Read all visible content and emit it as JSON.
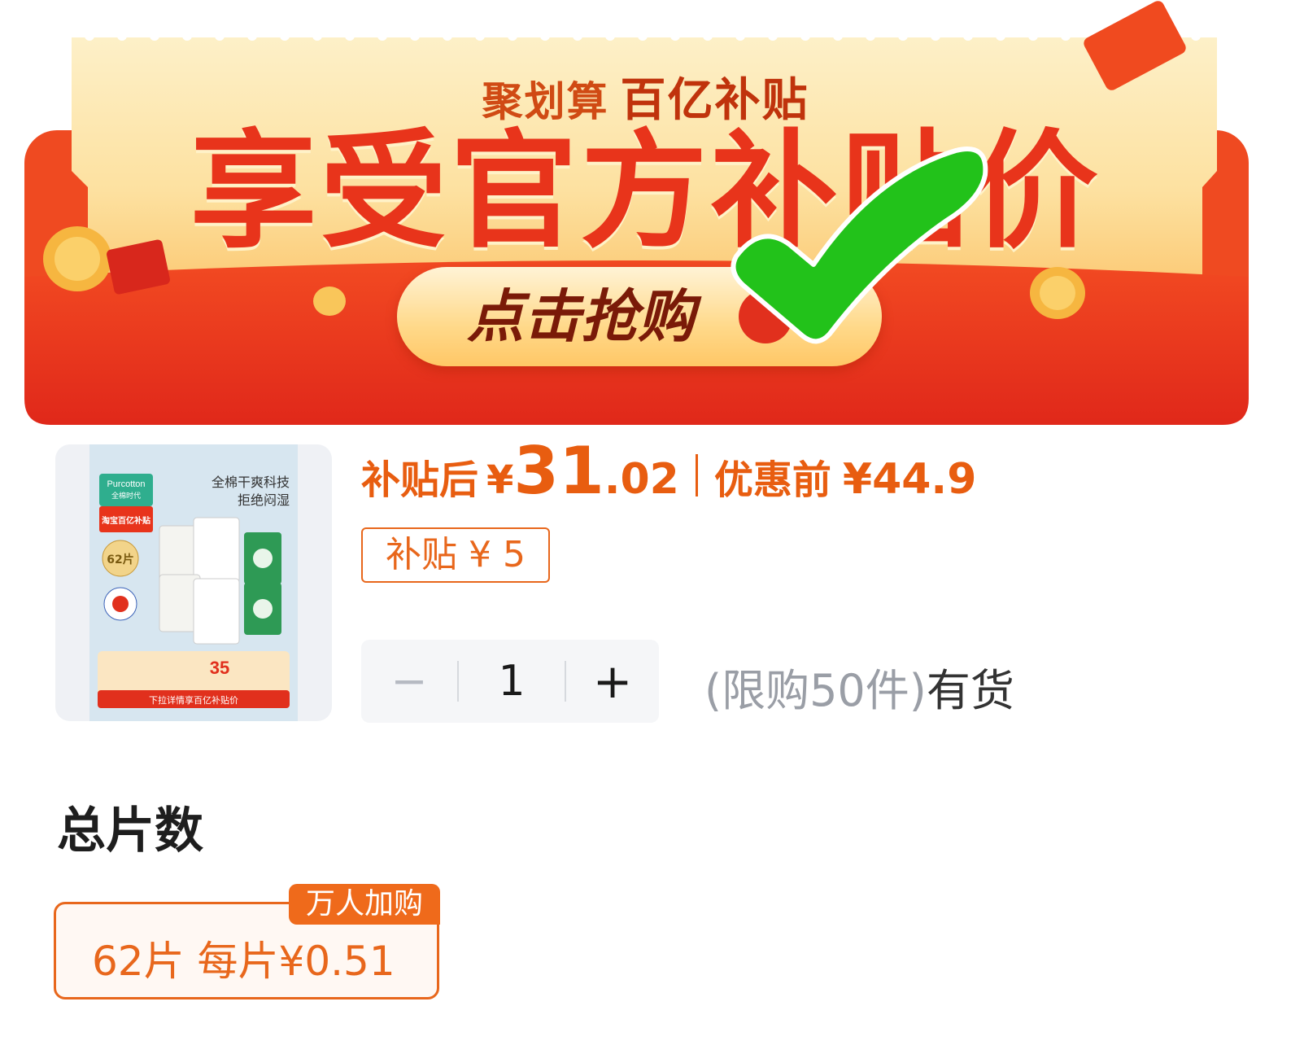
{
  "banner": {
    "brand_left": "聚划算",
    "brand_right": "百亿补贴",
    "headline": "享受官方补贴价",
    "cta_label": "点击抢购"
  },
  "product": {
    "image_alt": "Purcotton 全棉时代 全棉干爽科技 拒绝闷湿",
    "image_text": {
      "brand": "Purcotton",
      "brand_cn": "全棉时代",
      "tag": "淘宝百亿补贴",
      "headline1": "全棉干爽科技",
      "headline2": "拒绝闷湿",
      "count_badge": "62片",
      "bottom_bar": "下拉详情享百亿补贴价",
      "promo_price": "35"
    },
    "price_after_label": "补贴后",
    "price_after_currency": "¥",
    "price_after_int": "31",
    "price_after_dec": ".02",
    "price_before_label": "优惠前",
    "price_before_value": "¥44.9",
    "subsidy_tag": "补贴 ¥ 5"
  },
  "quantity": {
    "minus": "−",
    "value": "1",
    "plus": "+",
    "limit_text": "(限购50件)",
    "stock_text": "有货"
  },
  "spec": {
    "section_title": "总片数",
    "option_label": "62片  每片¥0.51",
    "option_badge": "万人加购"
  },
  "colors": {
    "accent": "#e8671c",
    "price": "#e85d10",
    "banner_red": "#e8341b",
    "checkmark": "#22c21a"
  }
}
